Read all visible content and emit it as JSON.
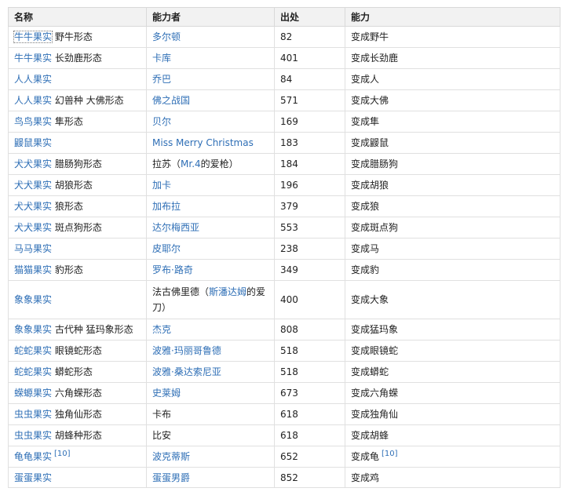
{
  "headers": [
    "名称",
    "能力者",
    "出处",
    "能力"
  ],
  "rows": [
    {
      "fruit": "牛牛果实",
      "form": "野牛形态",
      "user": "多尔顿",
      "user_linked": true,
      "ep": "82",
      "ability": "变成野牛"
    },
    {
      "fruit": "牛牛果实",
      "form": "长劲鹿形态",
      "user": "卡库",
      "user_linked": true,
      "ep": "401",
      "ability": "变成长劲鹿"
    },
    {
      "fruit": "人人果实",
      "form": "",
      "user": "乔巴",
      "user_linked": true,
      "ep": "84",
      "ability": "变成人"
    },
    {
      "fruit": "人人果实",
      "form": "幻兽种 大佛形态",
      "user": "佛之战国",
      "user_linked": true,
      "ep": "571",
      "ability": "变成大佛"
    },
    {
      "fruit": "鸟鸟果实",
      "form": "隼形态",
      "user": "贝尔",
      "user_linked": true,
      "ep": "169",
      "ability": "变成隼"
    },
    {
      "fruit": "鼹鼠果实",
      "form": "",
      "user": "Miss Merry Christmas",
      "user_linked": true,
      "ep": "183",
      "ability": "变成鼹鼠"
    },
    {
      "fruit": "犬犬果实",
      "form": "腊肠狗形态",
      "user": "拉苏",
      "user_linked": false,
      "user_note_pre": "（",
      "user_note_link": "Mr.4",
      "user_note_post": "的爱枪）",
      "ep": "184",
      "ability": "变成腊肠狗"
    },
    {
      "fruit": "犬犬果实",
      "form": "胡狼形态",
      "user": "加卡",
      "user_linked": true,
      "ep": "196",
      "ability": "变成胡狼"
    },
    {
      "fruit": "犬犬果实",
      "form": "狼形态",
      "user": "加布拉",
      "user_linked": true,
      "ep": "379",
      "ability": "变成狼"
    },
    {
      "fruit": "犬犬果实",
      "form": "斑点狗形态",
      "user": "达尔梅西亚",
      "user_linked": true,
      "ep": "553",
      "ability": "变成斑点狗"
    },
    {
      "fruit": "马马果实",
      "form": "",
      "user": "皮耶尔",
      "user_linked": true,
      "ep": "238",
      "ability": "变成马"
    },
    {
      "fruit": "猫猫果实",
      "form": "豹形态",
      "user": "罗布·路奇",
      "user_linked": true,
      "ep": "349",
      "ability": "变成豹"
    },
    {
      "fruit": "象象果实",
      "form": "",
      "user": "法古佛里德",
      "user_linked": false,
      "user_note_pre": "（",
      "user_note_link": "斯潘达姆",
      "user_note_post": "的爱刀）",
      "ep": "400",
      "ability": "变成大象",
      "tall": true
    },
    {
      "fruit": "象象果实",
      "form": "古代种 猛玛象形态",
      "user": "杰克",
      "user_linked": true,
      "ep": "808",
      "ability": "变成猛玛象"
    },
    {
      "fruit": "蛇蛇果实",
      "form": "眼镜蛇形态",
      "user": "波雅·玛丽哥鲁德",
      "user_linked": true,
      "ep": "518",
      "ability": "变成眼镜蛇"
    },
    {
      "fruit": "蛇蛇果实",
      "form": "蟒蛇形态",
      "user": "波雅·桑达索尼亚",
      "user_linked": true,
      "ep": "518",
      "ability": "变成蟒蛇"
    },
    {
      "fruit": "蝾螈果实",
      "form": "六角蝾形态",
      "user": "史莱姆",
      "user_linked": true,
      "ep": "673",
      "ability": "变成六角蝾"
    },
    {
      "fruit": "虫虫果实",
      "form": "独角仙形态",
      "user": "卡布",
      "user_linked": false,
      "ep": "618",
      "ability": "变成独角仙"
    },
    {
      "fruit": "虫虫果实",
      "form": "胡蜂种形态",
      "user": "比安",
      "user_linked": false,
      "ep": "618",
      "ability": "变成胡蜂"
    },
    {
      "fruit": "龟龟果实",
      "fruit_ref": "[10]",
      "form": "",
      "user": "波克蒂斯",
      "user_linked": true,
      "ep": "652",
      "ability": "变成龟",
      "ability_ref": "[10]"
    },
    {
      "fruit": "蛋蛋果实",
      "form": "",
      "user": "蛋蛋男爵",
      "user_linked": true,
      "ep": "852",
      "ability": "变成鸡"
    }
  ]
}
